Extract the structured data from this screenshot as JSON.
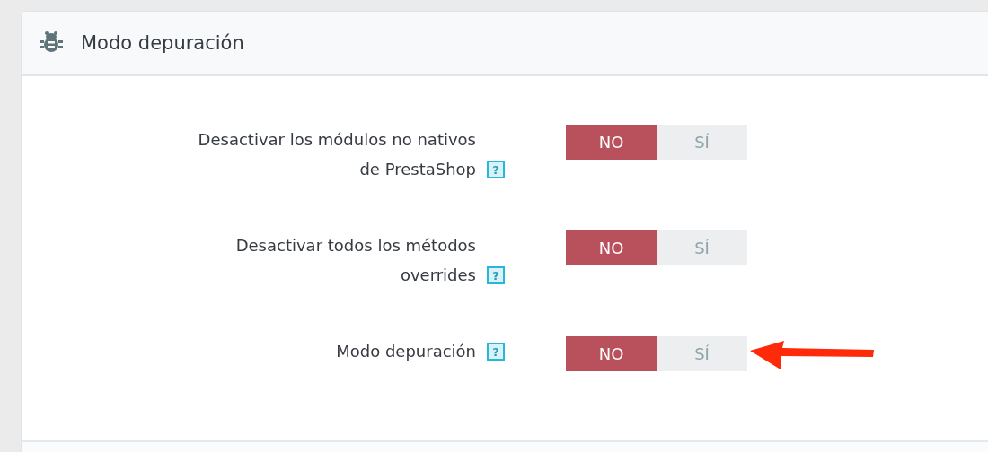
{
  "panel": {
    "title": "Modo depuración"
  },
  "settings": [
    {
      "label": "Desactivar los módulos no nativos de PrestaShop",
      "help": "?",
      "options": [
        {
          "label": "NO",
          "selected": true
        },
        {
          "label": "SÍ",
          "selected": false
        }
      ]
    },
    {
      "label": "Desactivar todos los métodos overrides",
      "help": "?",
      "options": [
        {
          "label": "NO",
          "selected": true
        },
        {
          "label": "SÍ",
          "selected": false
        }
      ]
    },
    {
      "label": "Modo depuración",
      "help": "?",
      "options": [
        {
          "label": "NO",
          "selected": true
        },
        {
          "label": "SÍ",
          "selected": false
        }
      ]
    }
  ]
}
